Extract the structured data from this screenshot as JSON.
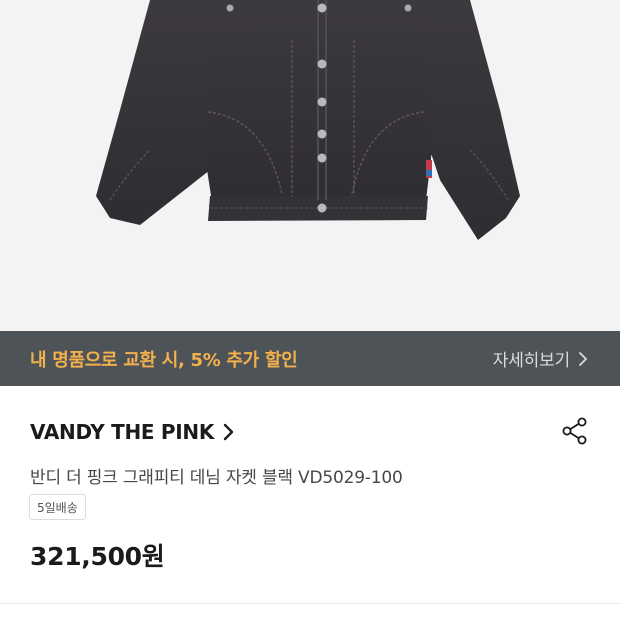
{
  "hero": {
    "image_alt": "Black denim jacket product photo"
  },
  "promo": {
    "text": "내 명품으로 교환 시, 5% 추가 할인",
    "more_label": "자세히보기"
  },
  "product": {
    "brand": "VANDY THE PINK",
    "name": "반디 더 핑크 그래피티 데님 자켓 블랙 VD5029-100",
    "shipping_badge": "5일배송",
    "price": "321,500원"
  },
  "icons": {
    "brand_chevron": "chevron-right-icon",
    "promo_chevron": "chevron-right-icon",
    "share": "share-icon"
  },
  "colors": {
    "promo_background": "#4e5357",
    "promo_text": "#f2b14d",
    "hero_background": "#f3f3f3"
  }
}
